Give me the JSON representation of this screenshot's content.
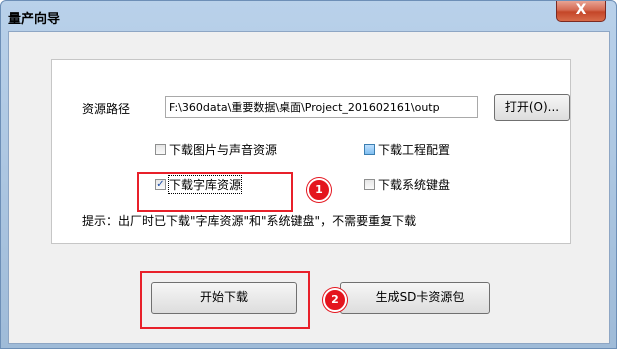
{
  "window": {
    "title": "量产向导",
    "close_glyph": "X"
  },
  "resource_path": {
    "label": "资源路径",
    "value": "F:\\360data\\重要数据\\桌面\\Project_201602161\\outp",
    "open_button": "打开(O)..."
  },
  "options": [
    {
      "label": "下载图片与声音资源",
      "checked": false
    },
    {
      "label": "下载工程配置",
      "checked": false
    },
    {
      "label": "下载字库资源",
      "checked": true
    },
    {
      "label": "下载系统键盘",
      "checked": false
    }
  ],
  "hint": "提示：出厂时已下载\"字库资源\"和\"系统键盘\"，不需要重复下载",
  "buttons": {
    "start": "开始下载",
    "generate_sd": "生成SD卡资源包"
  },
  "annotations": {
    "badge1": "1",
    "badge2": "2",
    "color": "#e8202a"
  }
}
